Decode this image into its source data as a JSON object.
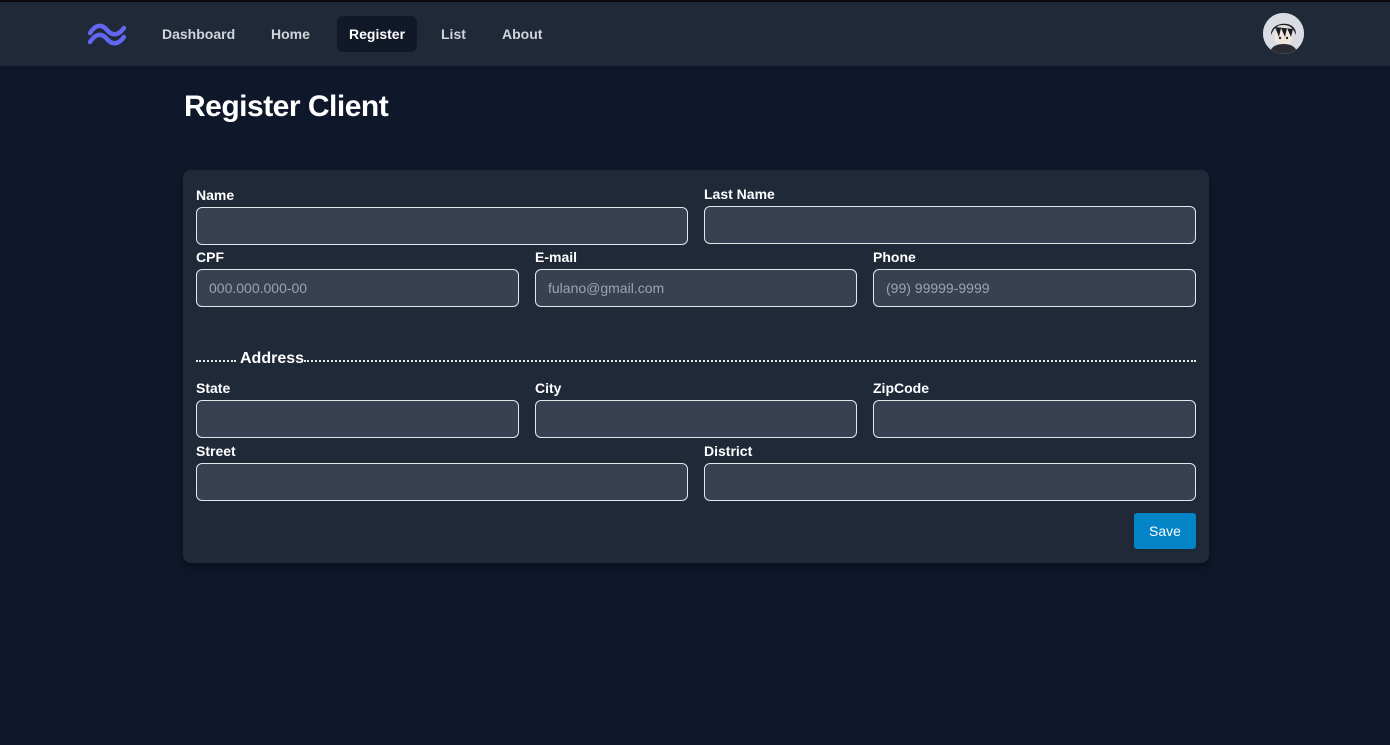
{
  "nav": {
    "items": [
      {
        "label": "Dashboard"
      },
      {
        "label": "Home"
      },
      {
        "label": "Register"
      },
      {
        "label": "List"
      },
      {
        "label": "About"
      }
    ],
    "active": "Register"
  },
  "page": {
    "title": "Register Client"
  },
  "form": {
    "name": {
      "label": "Name",
      "value": "",
      "placeholder": ""
    },
    "last_name": {
      "label": "Last Name",
      "value": "",
      "placeholder": ""
    },
    "cpf": {
      "label": "CPF",
      "value": "",
      "placeholder": "000.000.000-00"
    },
    "email": {
      "label": "E-mail",
      "value": "",
      "placeholder": "fulano@gmail.com"
    },
    "phone": {
      "label": "Phone",
      "value": "",
      "placeholder": "(99) 99999-9999"
    },
    "address_title": "Address",
    "state": {
      "label": "State",
      "value": "",
      "placeholder": ""
    },
    "city": {
      "label": "City",
      "value": "",
      "placeholder": ""
    },
    "zipcode": {
      "label": "ZipCode",
      "value": "",
      "placeholder": ""
    },
    "street": {
      "label": "Street",
      "value": "",
      "placeholder": ""
    },
    "district": {
      "label": "District",
      "value": "",
      "placeholder": ""
    },
    "save_label": "Save"
  },
  "icons": {
    "logo": "tailwind-logo-icon",
    "avatar": "user-avatar"
  },
  "colors": {
    "accent": "#0284c7",
    "logo": "#6366f1",
    "background": "#0f172a",
    "navbar": "#1f2937"
  }
}
